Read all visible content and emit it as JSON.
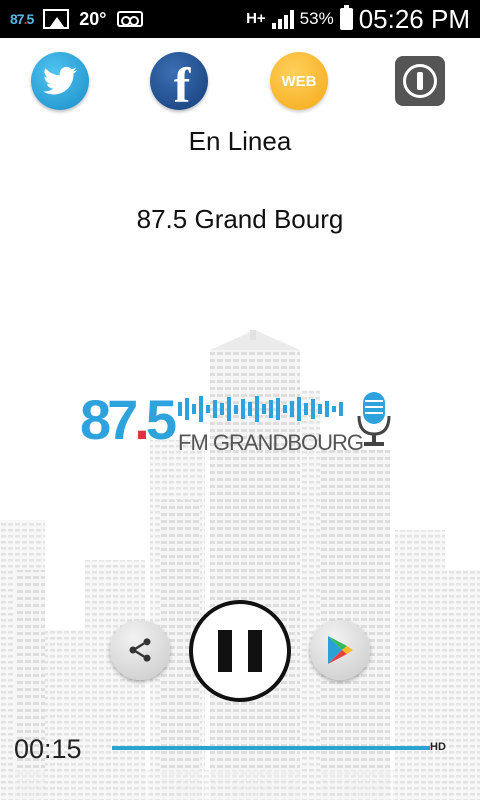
{
  "status_bar": {
    "app_logo_top": "87",
    "app_logo_dot": ".",
    "app_logo_five": "5",
    "temperature": "20°",
    "network_type": "H+",
    "battery": "53%",
    "time": "05:26 PM"
  },
  "social": {
    "twitter_icon": "twitter-bird-icon",
    "facebook_letter": "f",
    "web_label": "WEB",
    "exit_icon": "power-icon"
  },
  "player": {
    "status": "En Linea",
    "station": "87.5 Grand Bourg",
    "elapsed": "00:15",
    "quality_badge": "HD",
    "state": "playing"
  },
  "logo": {
    "number": "87",
    "dot": ".",
    "five": "5",
    "wordmark": "FM GRANDBOURG"
  },
  "colors": {
    "accent": "#2ea2dc",
    "logo_red": "#e0333c",
    "web": "#f5a91a",
    "facebook": "#1f4f92",
    "twitter": "#2aa3d3"
  }
}
